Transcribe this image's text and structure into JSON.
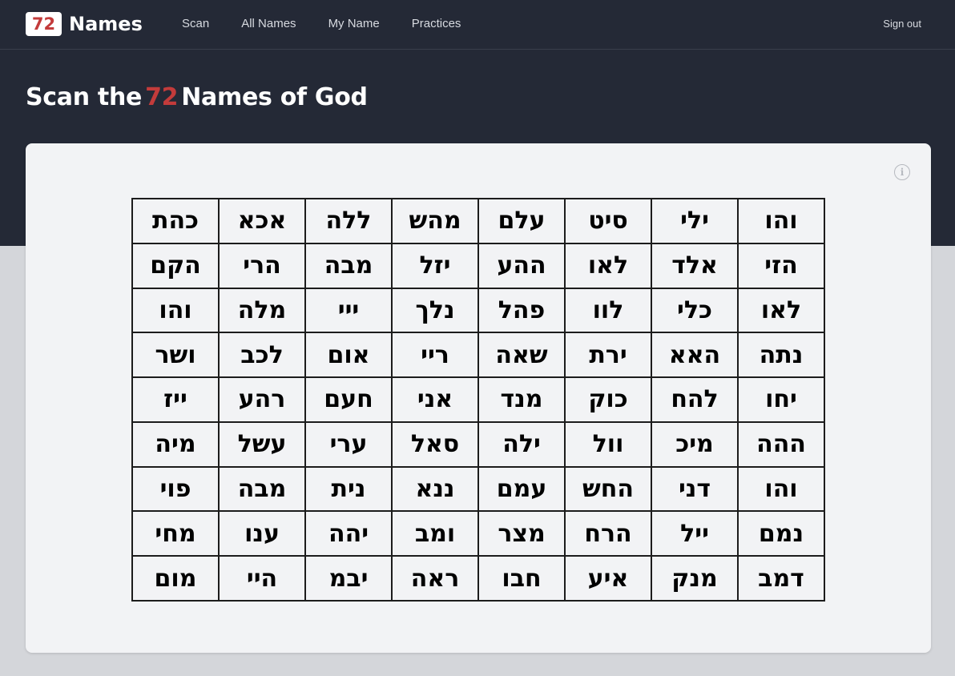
{
  "header": {
    "logo_number": "72",
    "logo_text": "Names",
    "nav": [
      "Scan",
      "All Names",
      "My Name",
      "Practices"
    ],
    "signout": "Sign out"
  },
  "page": {
    "title_before": "Scan the",
    "title_accent": "72",
    "title_after": "Names of God"
  },
  "info_icon": "info-icon",
  "colors": {
    "dark_bg": "#242936",
    "accent": "#c33b3b",
    "card_bg": "#f2f3f5",
    "page_bg": "#d4d6da"
  },
  "grid": {
    "rows": [
      [
        "כהת",
        "אכא",
        "ללה",
        "מהש",
        "עלם",
        "סיט",
        "ילי",
        "והו"
      ],
      [
        "הקם",
        "הרי",
        "מבה",
        "יזל",
        "ההע",
        "לאו",
        "אלד",
        "הזי"
      ],
      [
        "והו",
        "מלה",
        "ייי",
        "נלך",
        "פהל",
        "לוו",
        "כלי",
        "לאו"
      ],
      [
        "ושר",
        "לכב",
        "אום",
        "ריי",
        "שאה",
        "ירת",
        "האא",
        "נתה"
      ],
      [
        "ייז",
        "רהע",
        "חעם",
        "אני",
        "מנד",
        "כוק",
        "להח",
        "יחו"
      ],
      [
        "מיה",
        "עשל",
        "ערי",
        "סאל",
        "ילה",
        "וול",
        "מיכ",
        "ההה"
      ],
      [
        "פוי",
        "מבה",
        "נית",
        "ננא",
        "עמם",
        "החש",
        "דני",
        "והו"
      ],
      [
        "מחי",
        "ענו",
        "יהה",
        "ומב",
        "מצר",
        "הרח",
        "ייל",
        "נמם"
      ],
      [
        "מום",
        "היי",
        "יבמ",
        "ראה",
        "חבו",
        "איע",
        "מנק",
        "דמב"
      ]
    ]
  }
}
